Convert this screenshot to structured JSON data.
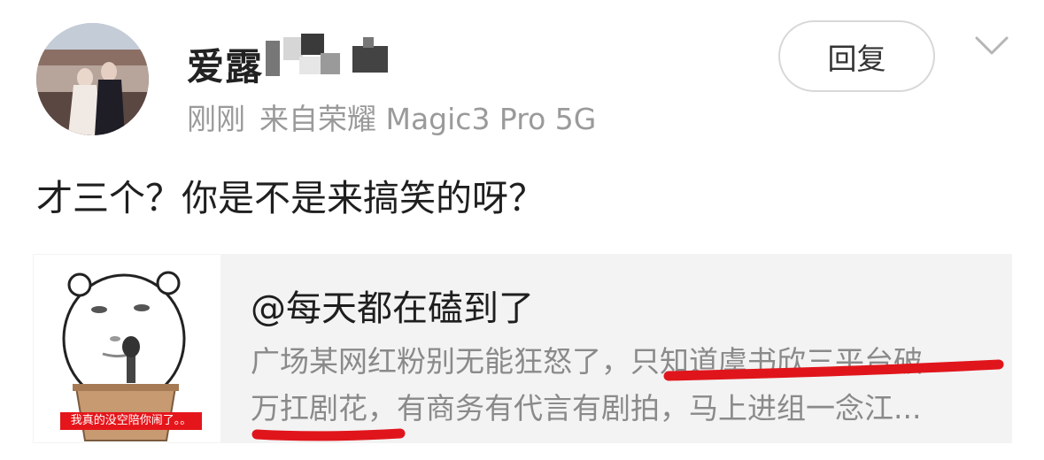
{
  "comment": {
    "username": "爱露",
    "time": "刚刚",
    "source": "来自荣耀 Magic3 Pro 5G",
    "reply_label": "回复",
    "text": "才三个？你是不是来搞笑的呀？"
  },
  "quoted": {
    "user": "@每天都在磕到了",
    "excerpt_line1": "广场某网红粉别无能狂怒了，只知道虞书欣三平台破",
    "excerpt_line2": "万扛剧花，有商务有代言有剧拍，马上进组一念江...",
    "thumbnail_caption": "我真的没空陪你闹了。。"
  },
  "icons": {
    "expand": "chevron-down-icon"
  },
  "colors": {
    "underline": "#e0151b",
    "meta_text": "#9a9a9a",
    "card_bg": "#f3f3f3"
  }
}
